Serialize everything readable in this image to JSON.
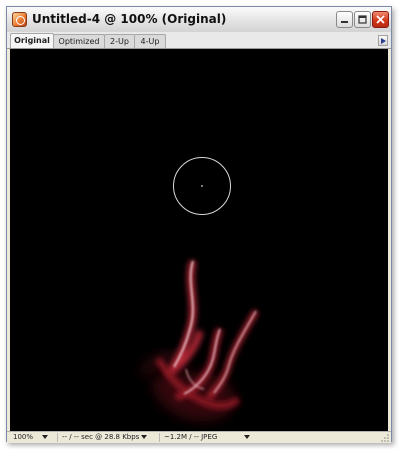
{
  "window": {
    "title": "Untitled-4 @ 100% (Original)",
    "icon": "fireworks-document-icon"
  },
  "tabs": [
    {
      "label": "Original",
      "active": true
    },
    {
      "label": "Optimized",
      "active": false
    },
    {
      "label": "2-Up",
      "active": false
    },
    {
      "label": "4-Up",
      "active": false
    }
  ],
  "canvas": {
    "background": "#000000",
    "cursor": "circular-brush-cursor",
    "artwork": "red-smoke-flame"
  },
  "status": {
    "zoom": "100%",
    "download_time": "-- / -- sec @ 28.8 Kbps",
    "file_info": "~1.2M / -- JPEG"
  },
  "colors": {
    "close_button": "#d3381a",
    "flame": "#c03040"
  }
}
